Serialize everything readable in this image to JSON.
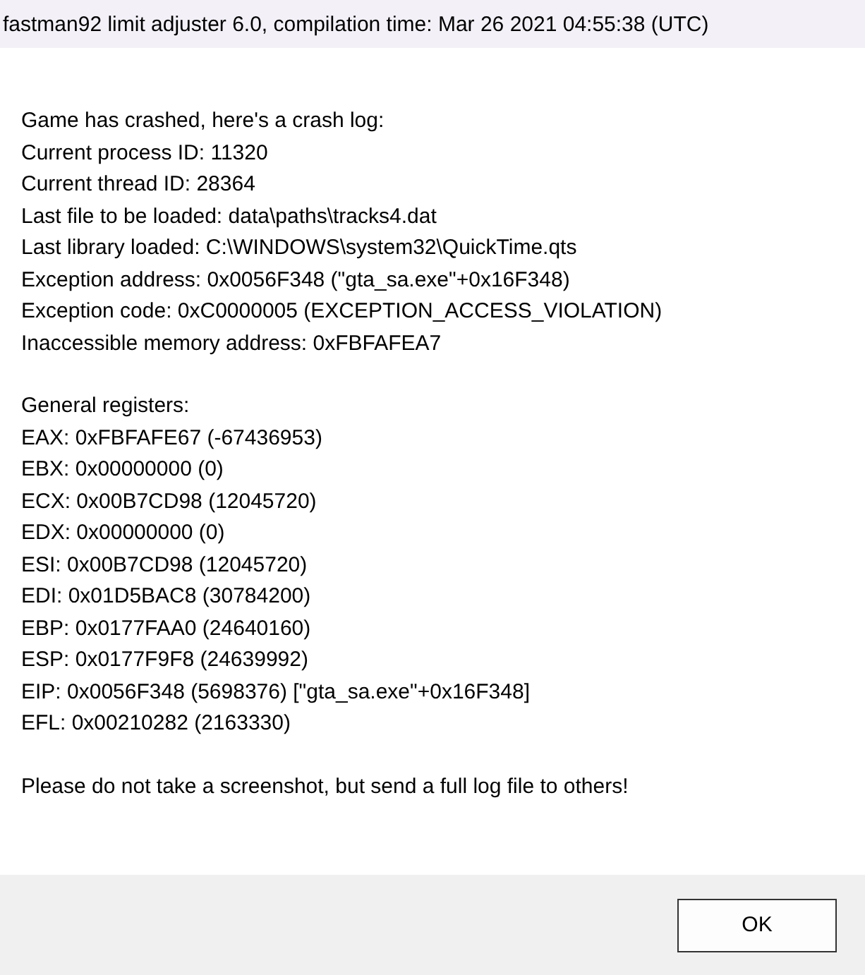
{
  "window": {
    "title": "fastman92 limit adjuster 6.0, compilation time: Mar 26 2021 04:55:38 (UTC)"
  },
  "message": {
    "sections": [
      {
        "lines": [
          "Game has crashed, here's a crash log:",
          "Current process ID: 11320",
          "Current thread ID: 28364",
          "Last file to be loaded: data\\paths\\tracks4.dat",
          "Last library loaded: C:\\WINDOWS\\system32\\QuickTime.qts",
          "Exception address: 0x0056F348 (\"gta_sa.exe\"+0x16F348)",
          "Exception code: 0xC0000005 (EXCEPTION_ACCESS_VIOLATION)",
          "Inaccessible memory address: 0xFBFAFEA7"
        ]
      },
      {
        "lines": [
          "General registers:",
          "EAX: 0xFBFAFE67 (-67436953)",
          "EBX: 0x00000000 (0)",
          "ECX: 0x00B7CD98 (12045720)",
          "EDX: 0x00000000 (0)",
          "ESI: 0x00B7CD98 (12045720)",
          "EDI: 0x01D5BAC8 (30784200)",
          "EBP: 0x0177FAA0 (24640160)",
          "ESP: 0x0177F9F8 (24639992)",
          "EIP: 0x0056F348 (5698376) [\"gta_sa.exe\"+0x16F348]",
          "EFL: 0x00210282 (2163330)"
        ]
      },
      {
        "lines": [
          "Please do not take a screenshot, but send a full log file to others!"
        ]
      }
    ]
  },
  "buttons": [
    {
      "label": "OK"
    }
  ]
}
